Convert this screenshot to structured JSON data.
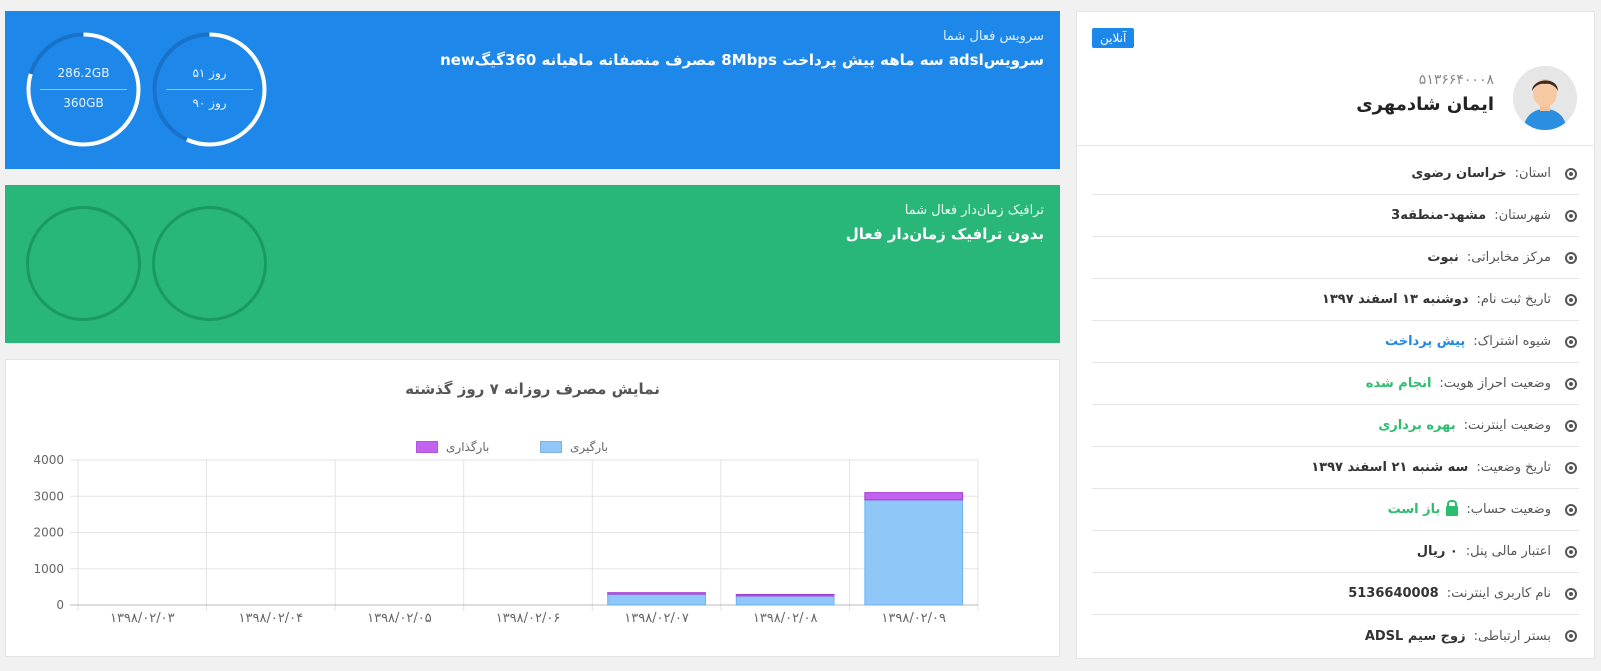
{
  "colors": {
    "primary": "#1e88ea",
    "success": "#29b679",
    "download": "#90c7f9",
    "upload": "#c462f0"
  },
  "service": {
    "subtitle": "سرویس فعال شما",
    "title": "سرویسadsl سه ماهه پیش پرداخت 8Mbps مصرف منصفانه ماهیانه 360گیگnew",
    "days_used": "۵۱ روز",
    "days_total": "۹۰ روز",
    "data_used": "286.2GB",
    "data_total": "360GB",
    "days_fraction": 0.567,
    "data_fraction": 0.795
  },
  "traffic": {
    "subtitle": "ترافیک زمان‌دار فعال شما",
    "title": "بدون ترافیک زمان‌دار فعال"
  },
  "chart_data": {
    "type": "bar",
    "title": "نمایش مصرف روزانه ۷ روز گذشته",
    "categories": [
      "۱۳۹۸/۰۲/۰۳",
      "۱۳۹۸/۰۲/۰۴",
      "۱۳۹۸/۰۲/۰۵",
      "۱۳۹۸/۰۲/۰۶",
      "۱۳۹۸/۰۲/۰۷",
      "۱۳۹۸/۰۲/۰۸",
      "۱۳۹۸/۰۲/۰۹"
    ],
    "series": [
      {
        "name": "بارگیری",
        "values": [
          0,
          0,
          0,
          0,
          300,
          250,
          2900
        ]
      },
      {
        "name": "بارگذاری",
        "values": [
          0,
          0,
          0,
          0,
          40,
          40,
          200
        ]
      }
    ],
    "stacked": true,
    "ylim": [
      0,
      4000
    ],
    "yticks": [
      "0",
      "1000",
      "2000",
      "3000",
      "4000"
    ],
    "legend": "top-center",
    "grid": true
  },
  "profile": {
    "status_badge": "آنلاین",
    "phone": "۵۱۳۶۶۴۰۰۰۸",
    "name": "ایمان شادمهری",
    "items": [
      {
        "label": "استان:",
        "value": "خراسان رضوی"
      },
      {
        "label": "شهرستان:",
        "value": "مشهد-منطقه3"
      },
      {
        "label": "مرکز مخابراتی:",
        "value": "نبوت"
      },
      {
        "label": "تاریخ ثبت نام:",
        "value": "دوشنبه ۱۳ اسفند ۱۳۹۷"
      },
      {
        "label": "شیوه اشتراک:",
        "value": "پیش پرداخت"
      },
      {
        "label": "وضعیت احراز هویت:",
        "value": "انجام شده"
      },
      {
        "label": "وضعیت اینترنت:",
        "value": "بهره برداری"
      },
      {
        "label": "تاریخ وضعیت:",
        "value": "سه شنبه ۲۱ اسفند ۱۳۹۷"
      },
      {
        "label": "وضعیت حساب:",
        "value": "باز است"
      },
      {
        "label": "اعتبار مالی پنل:",
        "value": "۰ ریال"
      },
      {
        "label": "نام کاربری اینترنت:",
        "value": "5136640008"
      },
      {
        "label": "بستر ارتباطی:",
        "value": "زوج سیم ADSL"
      }
    ]
  }
}
